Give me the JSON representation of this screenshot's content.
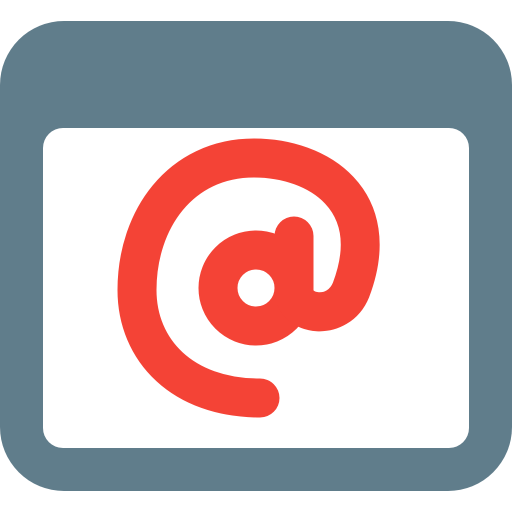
{
  "icon": {
    "name": "email-browser-window-icon",
    "glyph": "at-sign",
    "colors": {
      "frame": "#607D8B",
      "content": "#FFFFFF",
      "symbol": "#F44336"
    }
  }
}
